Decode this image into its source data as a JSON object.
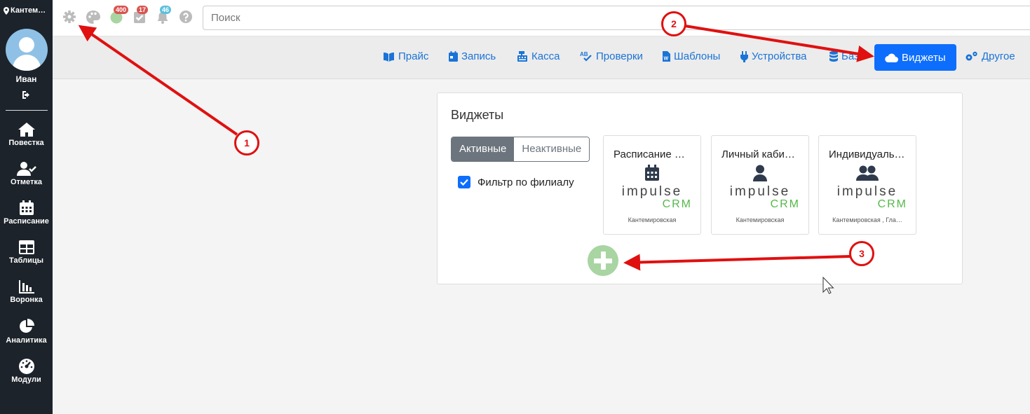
{
  "sidebar": {
    "branch": "Кантем…",
    "user_name": "Иван",
    "items": [
      {
        "label": "Повестка"
      },
      {
        "label": "Отметка"
      },
      {
        "label": "Расписание"
      },
      {
        "label": "Таблицы"
      },
      {
        "label": "Воронка"
      },
      {
        "label": "Аналитика"
      },
      {
        "label": "Модули"
      }
    ]
  },
  "topbar": {
    "badges": {
      "messages": "400",
      "tasks": "17",
      "notifications": "46"
    },
    "search_placeholder": "Поиск"
  },
  "subnav": {
    "tabs": [
      {
        "label": "Прайс"
      },
      {
        "label": "Запись"
      },
      {
        "label": "Касса"
      },
      {
        "label": "Проверки"
      },
      {
        "label": "Шаблоны"
      },
      {
        "label": "Устройства"
      },
      {
        "label": "База"
      },
      {
        "label": "Виджеты"
      },
      {
        "label": "Другое"
      }
    ]
  },
  "widgets_panel": {
    "title": "Виджеты",
    "toggle": {
      "active": "Активные",
      "inactive": "Неактивные"
    },
    "filter_label": "Фильтр по филиалу",
    "widgets": [
      {
        "title": "Расписание …",
        "icon": "calendar-icon",
        "brand_top": "impulse",
        "brand_bottom": "CRM",
        "branch": "Кантемировская"
      },
      {
        "title": "Личный каби…",
        "icon": "user-icon",
        "brand_top": "impulse",
        "brand_bottom": "CRM",
        "branch": "Кантемировская"
      },
      {
        "title": "Индивидуаль…",
        "icon": "users-icon",
        "brand_top": "impulse",
        "brand_bottom": "CRM",
        "branch": "Кантемировская , Гла…"
      }
    ]
  },
  "annotations": [
    "1",
    "2",
    "3"
  ],
  "colors": {
    "sidebar_bg": "#1c232b",
    "accent": "#0d6efd",
    "link": "#1a73d6",
    "annotation_red": "#e01010",
    "brand_green": "#54b948"
  }
}
